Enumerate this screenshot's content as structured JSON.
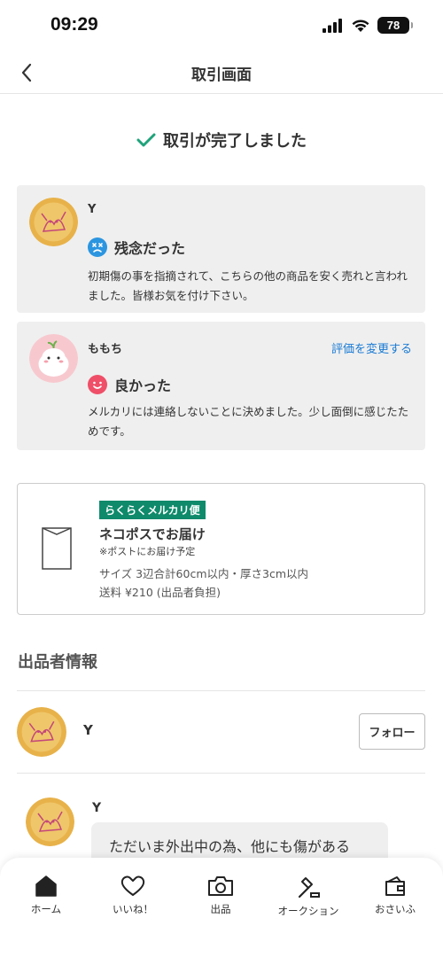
{
  "status_bar": {
    "time": "09:29",
    "battery": "78"
  },
  "nav": {
    "title": "取引画面"
  },
  "complete": {
    "message": "取引が完了しました"
  },
  "reviews": [
    {
      "name": "Y",
      "rating": "残念だった",
      "comment": "初期傷の事を指摘されて、こちらの他の商品を安く売れと言われました。皆様お気を付け下さい。"
    },
    {
      "name": "ももち",
      "change_link": "評価を変更する",
      "rating": "良かった",
      "comment": "メルカリには連絡しないことに決めました。少し面倒に感じたためです。"
    }
  ],
  "shipping": {
    "badge": "らくらくメルカリ便",
    "method": "ネコポスでお届け",
    "note": "※ポストにお届け予定",
    "size": "サイズ  3辺合計60cm以内・厚さ3cm以内",
    "fee": "送料  ¥210 (出品者負担)"
  },
  "seller_section": {
    "title": "出品者情報",
    "name": "Y",
    "follow_label": "フォロー"
  },
  "message": {
    "name": "Y",
    "text": "ただいま外出中の為、他にも傷がある"
  },
  "tabs": [
    {
      "label": "ホーム",
      "icon": "home-icon"
    },
    {
      "label": "いいね！",
      "icon": "heart-icon"
    },
    {
      "label": "出品",
      "icon": "camera-icon"
    },
    {
      "label": "オークション",
      "icon": "gavel-icon"
    },
    {
      "label": "おさいふ",
      "icon": "wallet-icon"
    }
  ],
  "colors": {
    "accent_green": "#0f8a6b",
    "link_blue": "#1a7bd4",
    "check_green": "#1fa37a",
    "sad_blue": "#2b95e0",
    "happy_red": "#ef4f68"
  }
}
